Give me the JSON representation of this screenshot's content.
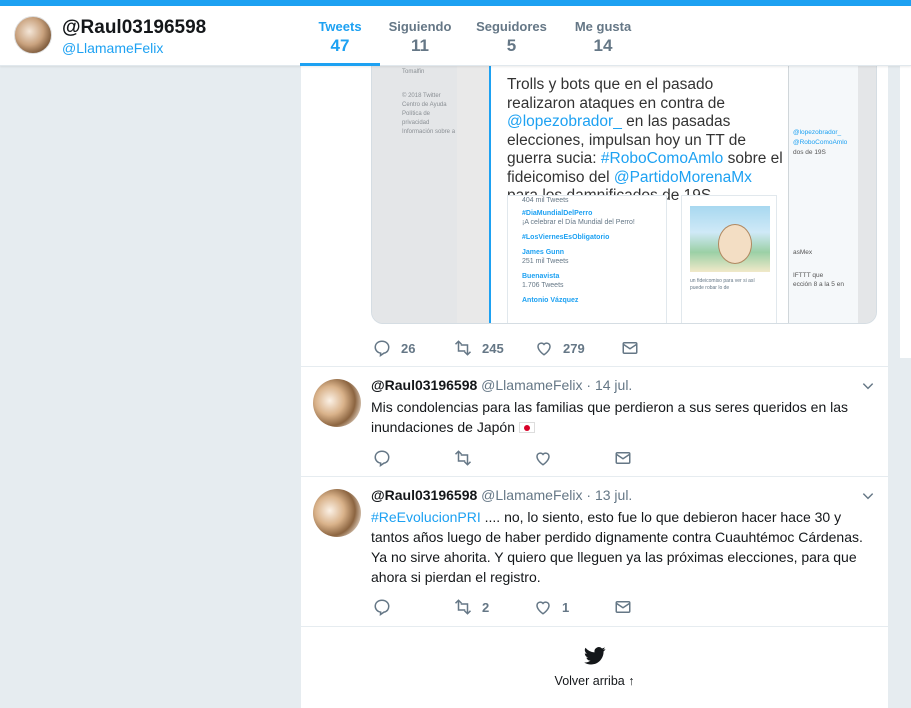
{
  "profile": {
    "name": "@Raul03196598",
    "handle": "@LlamameFelix"
  },
  "nav": [
    {
      "label": "Tweets",
      "count": "47"
    },
    {
      "label": "Siguiendo",
      "count": "11"
    },
    {
      "label": "Seguidores",
      "count": "5"
    },
    {
      "label": "Me gusta",
      "count": "14"
    }
  ],
  "media": {
    "left_top": [
      "Tomalfin"
    ],
    "left_bottom": [
      "© 2018 Twitter",
      "Centro de Ayuda",
      "Política de privacidad",
      "Información sobre a"
    ],
    "card_text_parts": {
      "p1": "Trolls y bots que en el pasado realizaron ataques en contra de ",
      "m1": "@lopezobrador_",
      "p2": " en las pasadas elecciones, impulsan hoy un TT de guerra sucia: ",
      "m2": "#RoboComoAmlo",
      "p3": " sobre el fideicomiso del ",
      "m3": "@PartidoMorenaMx",
      "p4": " para los damnificados de 19S"
    },
    "trends": [
      {
        "text": "404 mil Tweets",
        "kind": "sub"
      },
      {
        "text": "#DiaMundialDelPerro",
        "kind": "tag"
      },
      {
        "text": "¡A celebrar el Día Mundial del Perro!",
        "kind": "sub"
      },
      {
        "text": "#LosViernesEsObligatorio",
        "kind": "tag"
      },
      {
        "text": "James Gunn",
        "kind": "tag"
      },
      {
        "text": "251 mil Tweets",
        "kind": "sub"
      },
      {
        "text": "Buenavista",
        "kind": "tag"
      },
      {
        "text": "1.706 Tweets",
        "kind": "sub"
      },
      {
        "text": "Antonio Vázquez",
        "kind": "tag"
      }
    ],
    "thumb_caption": "un fideicomiso para ver si así puede robar lo de",
    "right_texts": [
      "@lopezobrador_",
      "@RoboComoAmlo",
      "dos de 19S",
      "asMex",
      "IFTTT que",
      "ección 8 a la 5 en"
    ]
  },
  "tweet1_actions": {
    "replies": "26",
    "retweets": "245",
    "likes": "279"
  },
  "tweets": [
    {
      "name": "@Raul03196598",
      "meta": "@LlamameFelix · 14 jul.",
      "text": "Mis condolencias para las familias que perdieron a sus seres queridos en las inundaciones de Japón",
      "replies": "",
      "retweets": "",
      "likes": ""
    },
    {
      "name": "@Raul03196598",
      "meta": "@LlamameFelix · 13 jul.",
      "hashtag": "#ReEvolucionPRI",
      "text": " .... no, lo siento, esto fue lo que debieron hacer hace 30 y tantos años luego de haber perdido dignamente contra Cuauhtémoc Cárdenas. Ya no sirve ahorita. Y quiero que lleguen ya las próximas elecciones, para que ahora si pierdan el registro.",
      "replies": "",
      "retweets": "2",
      "likes": "1"
    }
  ],
  "footer": {
    "back_to_top": "Volver arriba ↑"
  },
  "colors": {
    "accent": "#1da1f2",
    "background": "#e6ecf0"
  }
}
